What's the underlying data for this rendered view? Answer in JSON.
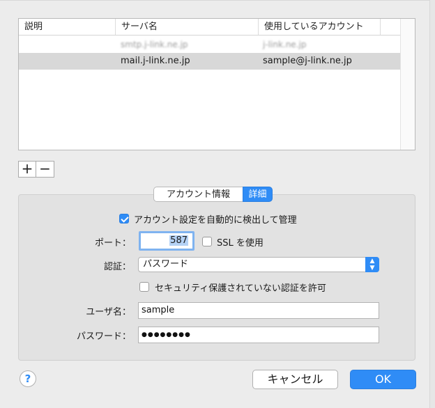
{
  "table": {
    "columns": [
      "説明",
      "サーバ名",
      "使用しているアカウント"
    ],
    "rows": [
      {
        "description": "",
        "server": "smtp.j-link.ne.jp",
        "account": "j-link.ne.jp"
      },
      {
        "description": "",
        "server": "mail.j-link.ne.jp",
        "account": "sample@j-link.ne.jp"
      }
    ],
    "selected_row": 1
  },
  "list_buttons": {
    "add": "+",
    "remove": "−"
  },
  "tabs": {
    "account_info": "アカウント情報",
    "detail": "詳細",
    "active": "詳細"
  },
  "settings": {
    "auto_detect_label": "アカウント設定を自動的に検出して管理",
    "auto_detect_checked": true,
    "port_label": "ポート：",
    "port_value": "587",
    "ssl_label": "SSL を使用",
    "ssl_checked": false,
    "auth_label": "認証：",
    "auth_value": "パスワード",
    "insecure_label": "セキュリティ保護されていない認証を許可",
    "insecure_checked": false,
    "username_label": "ユーザ名：",
    "username_value": "sample",
    "password_label": "パスワード：",
    "password_value": "●●●●●●●●"
  },
  "buttons": {
    "help": "?",
    "cancel": "キャンセル",
    "ok": "OK"
  },
  "colors": {
    "accent": "#2f8cf6",
    "selected_row": "#d8d8d8"
  }
}
